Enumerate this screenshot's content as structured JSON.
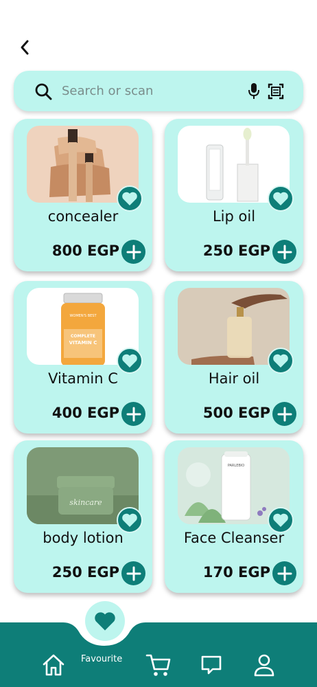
{
  "search": {
    "placeholder": "Search or scan"
  },
  "products": [
    {
      "name": "concealer",
      "price": "800 EGP"
    },
    {
      "name": "Lip oil",
      "price": "250 EGP"
    },
    {
      "name": "Vitamin C",
      "price": "400 EGP"
    },
    {
      "name": "Hair oil",
      "price": "500 EGP"
    },
    {
      "name": "body lotion",
      "price": "250 EGP"
    },
    {
      "name": "Face Cleanser",
      "price": "170 EGP"
    }
  ],
  "product_image_text": {
    "vitamin_brand": "WOMEN'S BEST",
    "vitamin_line1": "COMPLETE",
    "vitamin_line2": "VITAMIN C",
    "jar_label": "skincare",
    "tube_brand": "PARLEBIO"
  },
  "nav": {
    "favourite_label": "Favourite"
  },
  "colors": {
    "accent": "#0e7e78",
    "card": "#bdf5ee"
  }
}
